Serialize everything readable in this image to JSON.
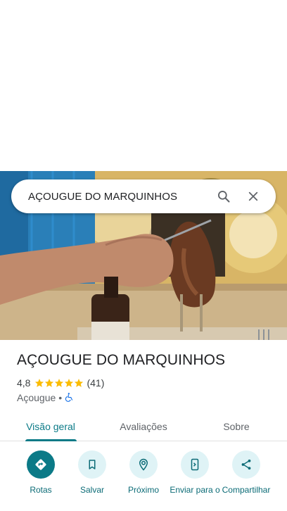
{
  "search": {
    "query": "AÇOUGUE DO MARQUINHOS",
    "search_icon": "search-icon",
    "close_icon": "close-icon"
  },
  "place": {
    "name": "AÇOUGUE DO MARQUINHOS",
    "rating": "4,8",
    "stars_filled": 5,
    "reviews": "(41)",
    "category": "Açougue",
    "separator": "•",
    "accessibility_icon": "wheelchair-icon"
  },
  "tabs": [
    {
      "label": "Visão geral",
      "active": true
    },
    {
      "label": "Avaliações",
      "active": false
    },
    {
      "label": "Sobre",
      "active": false
    }
  ],
  "actions": [
    {
      "label": "Rotas",
      "icon": "directions-icon"
    },
    {
      "label": "Salvar",
      "icon": "bookmark-icon"
    },
    {
      "label": "Próximo",
      "icon": "nearby-icon"
    },
    {
      "label": "Enviar para o",
      "icon": "send-to-phone-icon"
    },
    {
      "label": "Compartilhar",
      "icon": "share-icon"
    }
  ],
  "colors": {
    "accent": "#0b7a87",
    "accent_light": "#dff3f6",
    "star": "#fbbc04",
    "text_primary": "#202124",
    "text_secondary": "#5f6368"
  }
}
